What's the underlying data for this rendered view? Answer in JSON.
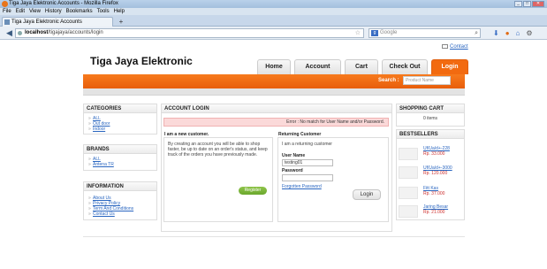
{
  "browser": {
    "window_title": "Tiga Jaya Elektronic Accounts - Mozilla Firefox",
    "menu": [
      "File",
      "Edit",
      "View",
      "History",
      "Bookmarks",
      "Tools",
      "Help"
    ],
    "tab_title": "Tiga Jaya Elektronic Accounts",
    "url_host": "localhost",
    "url_path": "/tigajaya/accounts/login",
    "search_placeholder": "Google"
  },
  "site": {
    "logo": "Tiga Jaya Elektronic",
    "contact": "Contact",
    "nav": [
      "Home",
      "Account",
      "Cart",
      "Check Out",
      "Login"
    ],
    "search_label": "Search :",
    "search_placeholder": "Product Name"
  },
  "sidebar": {
    "categories": {
      "title": "CATEGORIES",
      "items": [
        "ALL",
        "Out door",
        "Indoor"
      ]
    },
    "brands": {
      "title": "BRANDS",
      "items": [
        "ALL",
        "Antena TR"
      ]
    },
    "information": {
      "title": "INFORMATION",
      "items": [
        "About Us",
        "Privacy Policy",
        "Term And Conditions",
        "Contact Us"
      ]
    }
  },
  "login": {
    "title": "ACCOUNT LOGIN",
    "error": "Error : No match for User Name and/or Password.",
    "new": {
      "heading": "I am a new customer.",
      "text": "By creating an account you will be able to shop faster, be up to date on an order's status, and keep track of the orders you have previously made.",
      "button": "Register"
    },
    "returning": {
      "heading": "Returning Customer",
      "subheading": "I am a returning customer",
      "username_label": "User Name",
      "username_value": "testing01",
      "password_label": "Password",
      "password_value": "",
      "forgot": "Forgotten Password",
      "button": "Login"
    }
  },
  "cart": {
    "title": "SHOPPING CART",
    "text": "0 items"
  },
  "bestsellers": {
    "title": "BESTSELLERS",
    "items": [
      {
        "name": "Uf/Ua/d+-228",
        "price": "Rp. 33.000"
      },
      {
        "name": "Uf/Ua/d+-3000",
        "price": "Rp. 120.000"
      },
      {
        "name": "Fitt Kas",
        "price": "Rp. 37.000"
      },
      {
        "name": "Jaring Besar",
        "price": "Rp. 21.000"
      }
    ]
  },
  "colors": {
    "accent": "#f26a10",
    "link": "#2a66c0",
    "error_bg": "#fbd9d9",
    "register": "#7bb53a"
  }
}
